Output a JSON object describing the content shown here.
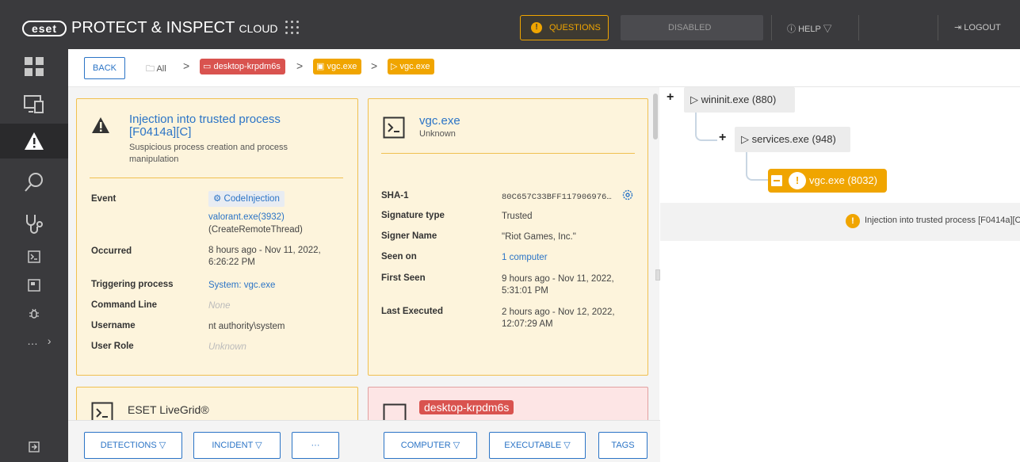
{
  "header": {
    "logo_text": "eset",
    "brand": "PROTECT & INSPECT",
    "brand_suffix": "CLOUD",
    "questions_label": "QUESTIONS",
    "disabled_label": "DISABLED",
    "help_label": "HELP",
    "logout_label": "LOGOUT"
  },
  "sidebar": {
    "items": [
      "dashboard-icon",
      "computers-icon",
      "alerts-icon",
      "search-icon",
      "stethoscope-icon",
      "terminal-icon",
      "card-icon",
      "bug-icon"
    ],
    "more_label": "…"
  },
  "breadcrumb": {
    "back_label": "BACK",
    "all_label": "All",
    "computer_label": "desktop-krpdm6s",
    "exe_label": "vgc.exe",
    "process_label": "vgc.exe"
  },
  "detection_card": {
    "title": "Injection into trusted process [F0414a][C]",
    "title_line1": "Injection into trusted process",
    "title_line2": "[F0414a][C]",
    "subtitle_line1": "Suspicious process creation and process",
    "subtitle_line2": "manipulation",
    "rows": {
      "event_label": "Event",
      "event_chip": "CodeInjection",
      "event_link": "valorant.exe(3932)",
      "event_extra": "(CreateRemoteThread)",
      "occurred_label": "Occurred",
      "occurred_line1": "8 hours ago - Nov 11, 2022,",
      "occurred_line2": "6:26:22 PM",
      "trigger_label": "Triggering process",
      "trigger_value": "System: vgc.exe",
      "cmd_label": "Command Line",
      "cmd_value": "None",
      "user_label": "Username",
      "user_value": "nt authority\\system",
      "role_label": "User Role",
      "role_value": "Unknown"
    }
  },
  "exe_card": {
    "title": "vgc.exe",
    "subtitle": "Unknown",
    "rows": {
      "sha_label": "SHA-1",
      "sha_value": "80C657C33BFF117906976…",
      "sig_label": "Signature type",
      "sig_value": "Trusted",
      "signer_label": "Signer Name",
      "signer_value": "\"Riot Games, Inc.\"",
      "seen_label": "Seen on",
      "seen_value": "1 computer",
      "first_label": "First Seen",
      "first_line1": "9 hours ago - Nov 11, 2022,",
      "first_line2": "5:31:01 PM",
      "last_label": "Last Executed",
      "last_line1": "2 hours ago - Nov 12, 2022,",
      "last_line2": "12:07:29 AM"
    }
  },
  "livegrid_card": {
    "title": "ESET LiveGrid®"
  },
  "computer_card": {
    "title": "desktop-krpdm6s"
  },
  "bottom_actions": {
    "detections": "DETECTIONS",
    "incident": "INCIDENT",
    "more": "···",
    "computer": "COMPUTER",
    "executable": "EXECUTABLE",
    "tags": "TAGS"
  },
  "process_tree": {
    "nodes": [
      {
        "label": "wininit.exe (880)"
      },
      {
        "label": "services.exe (948)"
      },
      {
        "label": "vgc.exe (8032)"
      }
    ],
    "detection_text": "Injection into trusted process [F0414a][C"
  },
  "colors": {
    "topbar": "#3a3a3d",
    "accent_blue": "#2b74c6",
    "warning": "#f0a500",
    "danger": "#d9534f"
  }
}
